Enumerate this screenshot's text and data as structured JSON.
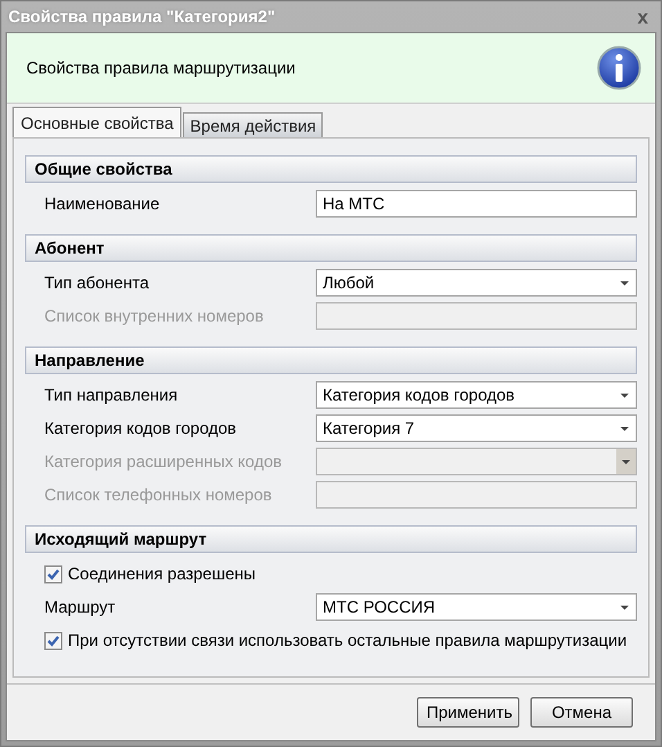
{
  "window": {
    "title": "Свойства правила \"Категория2\"",
    "close": "x"
  },
  "header": {
    "text": "Свойства правила маршрутизации"
  },
  "tabs": [
    {
      "label": "Основные свойства",
      "selected": true
    },
    {
      "label": "Время действия",
      "selected": false
    }
  ],
  "sections": [
    {
      "title": "Общие свойства",
      "rows": [
        {
          "kind": "text",
          "label": "Наименование",
          "value": "На МТС",
          "disabled": false
        }
      ]
    },
    {
      "title": "Абонент",
      "rows": [
        {
          "kind": "combo",
          "label": "Тип абонента",
          "value": "Любой",
          "disabled": false
        },
        {
          "kind": "text",
          "label": "Список внутренних номеров",
          "disabled": true
        }
      ]
    },
    {
      "title": "Направление",
      "rows": [
        {
          "kind": "combo",
          "label": "Тип направления",
          "value": "Категория кодов городов",
          "disabled": false
        },
        {
          "kind": "combo",
          "label": "Категория кодов городов",
          "value": "Категория 7",
          "disabled": false
        },
        {
          "kind": "combo",
          "label": "Категория расширенных кодов",
          "disabled": true
        },
        {
          "kind": "text",
          "label": "Список телефонных номеров",
          "disabled": true
        }
      ]
    },
    {
      "title": "Исходящий маршрут",
      "rows": [
        {
          "kind": "checkbox",
          "label": "Соединения разрешены",
          "checked": true
        },
        {
          "kind": "combo",
          "label": "Маршрут",
          "value": "МТС РОССИЯ",
          "disabled": false
        },
        {
          "kind": "checkbox",
          "label": "При отсутствии связи использовать остальные правила маршрутизации",
          "checked": true
        }
      ]
    }
  ],
  "buttons": [
    "Применить",
    "Отмена"
  ]
}
